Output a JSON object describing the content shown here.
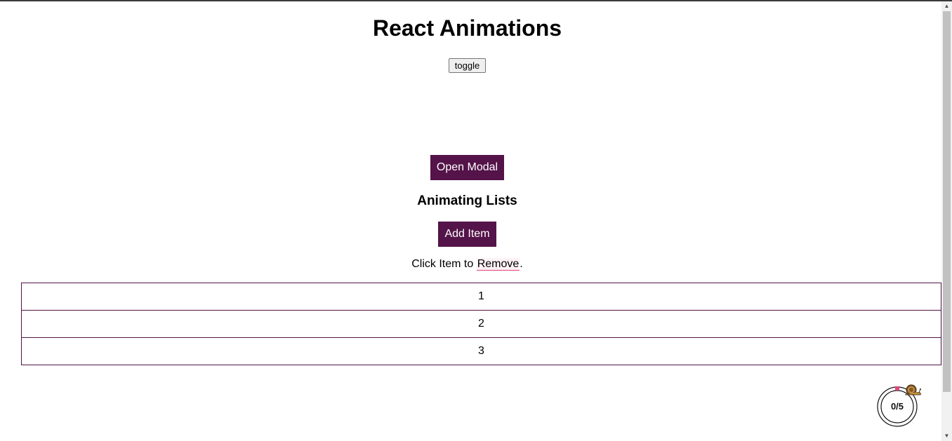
{
  "page": {
    "title": "React Animations",
    "toggle_label": "toggle",
    "open_modal_label": "Open Modal",
    "section_title": "Animating Lists",
    "add_item_label": "Add Item",
    "hint_prefix": "Click Item to ",
    "hint_link": "Remove",
    "hint_suffix": "."
  },
  "list": {
    "items": [
      "1",
      "2",
      "3"
    ]
  },
  "progress_widget": {
    "label": "0/5",
    "completed": 0,
    "total": 5
  },
  "colors": {
    "accent": "#541349",
    "remove_underline": "#e0457b",
    "widget_marker": "#e0457b"
  },
  "icons": {
    "widget_mascot": "snail-icon"
  }
}
